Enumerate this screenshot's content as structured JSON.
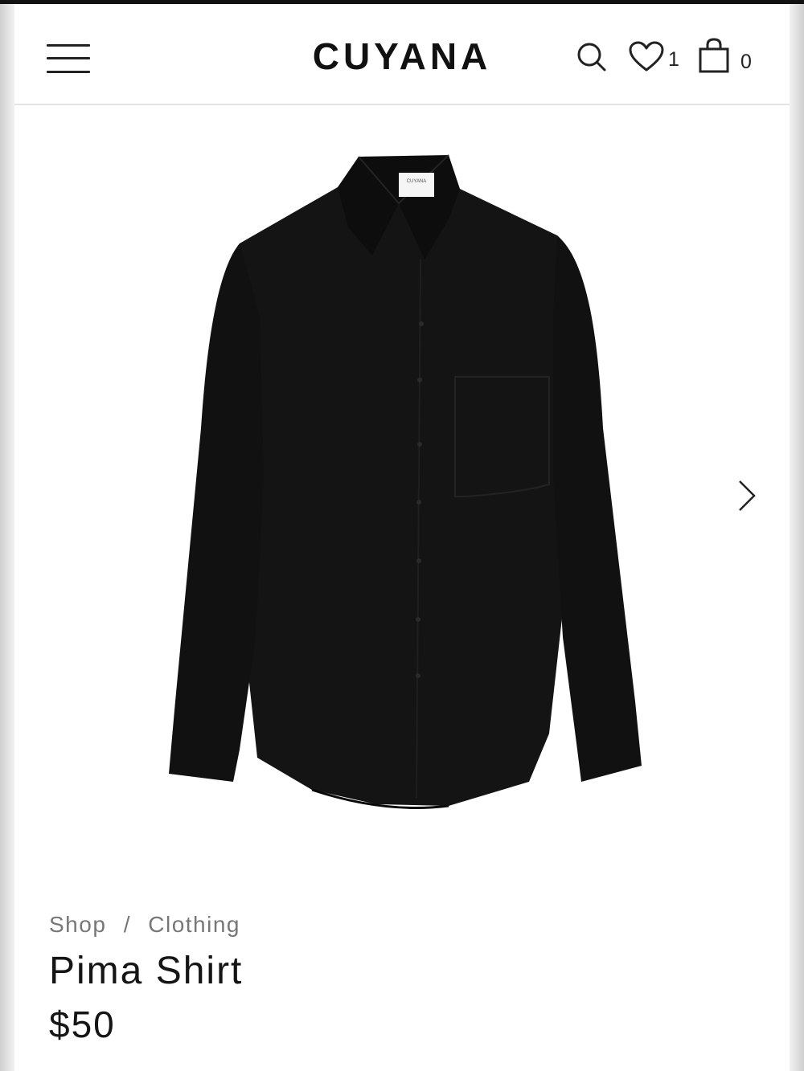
{
  "header": {
    "logo": "CUYANA",
    "wishlist_count": "1",
    "cart_count": "0"
  },
  "gallery": {
    "product_image_icon": "black-button-up-shirt",
    "shirt_label_text": "CUYANA"
  },
  "breadcrumb": {
    "items": [
      "Shop",
      "Clothing"
    ],
    "separator": "/"
  },
  "product": {
    "title": "Pima Shirt",
    "price": "$50"
  },
  "colors": {
    "text": "#151515",
    "muted": "#777777",
    "shirt": "#141414"
  }
}
